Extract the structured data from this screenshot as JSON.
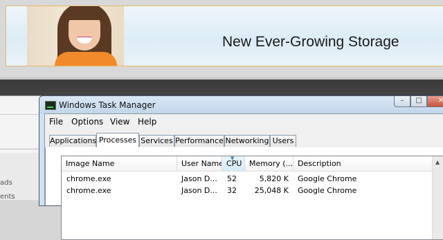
{
  "banner": {
    "headline": "New Ever-Growing Storage"
  },
  "background_window": {
    "links": [
      "ads",
      "ents"
    ]
  },
  "task_manager": {
    "title": "Windows Task Manager",
    "window_buttons": {
      "minimize": "–",
      "maximize": "□",
      "close": "✕"
    },
    "menu": [
      "File",
      "Options",
      "View",
      "Help"
    ],
    "tabs": [
      {
        "label": "Applications",
        "active": false
      },
      {
        "label": "Processes",
        "active": true
      },
      {
        "label": "Services",
        "active": false
      },
      {
        "label": "Performance",
        "active": false
      },
      {
        "label": "Networking",
        "active": false
      },
      {
        "label": "Users",
        "active": false
      }
    ],
    "columns": [
      "Image Name",
      "User Name",
      "CPU",
      "Memory (...",
      "Description"
    ],
    "sorted_column": "CPU",
    "rows": [
      {
        "image": "chrome.exe",
        "user": "Jason D...",
        "cpu": "52",
        "memory": "5,820 K",
        "description": "Google Chrome"
      },
      {
        "image": "chrome.exe",
        "user": "Jason D...",
        "cpu": "32",
        "memory": "25,048 K",
        "description": "Google Chrome"
      }
    ]
  },
  "colors": {
    "banner_border": "#e8b66a",
    "titlebar": "#cfe0f1",
    "sorted_header": "#d4ebf8"
  }
}
